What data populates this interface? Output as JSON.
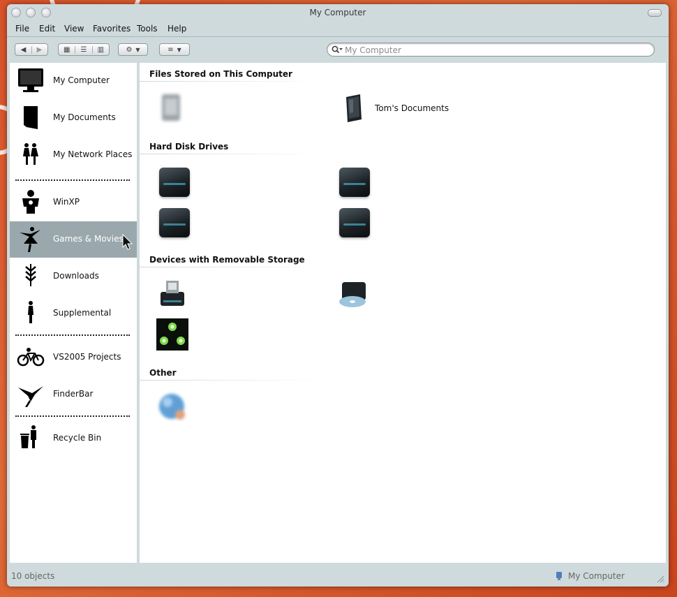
{
  "window": {
    "title": "My Computer"
  },
  "menu": [
    "File",
    "Edit",
    "View",
    "Favorites",
    "Tools",
    "Help"
  ],
  "toolbar": {
    "search_placeholder": "My Computer",
    "icons": [
      "back-arrow-icon",
      "forward-arrow-icon",
      "icon-view-icon",
      "list-view-icon",
      "column-view-icon",
      "gear-icon",
      "arrange-icon",
      "search-icon"
    ]
  },
  "sidebar": {
    "items": [
      {
        "label": "My Computer",
        "icon": "monitor-icon"
      },
      {
        "label": "My Documents",
        "icon": "folder-icon"
      },
      {
        "label": "My Network Places",
        "icon": "people-icon"
      },
      {
        "label": "WinXP",
        "icon": "silhouette-icon"
      },
      {
        "label": "Games & Movies",
        "icon": "dancer-icon",
        "selected": true
      },
      {
        "label": "Downloads",
        "icon": "chevrons-down-icon"
      },
      {
        "label": "Supplemental",
        "icon": "figure-icon"
      },
      {
        "label": "VS2005 Projects",
        "icon": "bicycle-icon"
      },
      {
        "label": "FinderBar",
        "icon": "hummingbird-icon"
      },
      {
        "label": "Recycle Bin",
        "icon": "trash-icon"
      }
    ]
  },
  "sections": [
    {
      "title": "Files Stored on This Computer"
    },
    {
      "title": "Hard Disk Drives"
    },
    {
      "title": "Devices with Removable Storage"
    },
    {
      "title": "Other"
    }
  ],
  "items": {
    "shared_docs": {
      "label": "",
      "icon": "document-folder-icon"
    },
    "toms_docs": {
      "label": "Tom's Documents",
      "icon": "document-folder-icon"
    },
    "drive1": {
      "label": "",
      "icon": "hard-drive-icon"
    },
    "drive2": {
      "label": "",
      "icon": "hard-drive-icon"
    },
    "drive3": {
      "label": "",
      "icon": "hard-drive-icon"
    },
    "drive4": {
      "label": "",
      "icon": "hard-drive-icon"
    },
    "floppy": {
      "label": "",
      "icon": "floppy-drive-icon"
    },
    "dvd": {
      "label": "",
      "icon": "dvd-drive-icon"
    },
    "removable": {
      "label": "",
      "icon": "removable-drive-icon"
    },
    "other": {
      "label": "",
      "icon": "globe-icon"
    }
  },
  "status": {
    "left": "10 objects",
    "right": "My Computer"
  },
  "colors": {
    "selection": "#9aa8ad",
    "chrome": "#cfdadd",
    "desktop": "#d8532a"
  }
}
